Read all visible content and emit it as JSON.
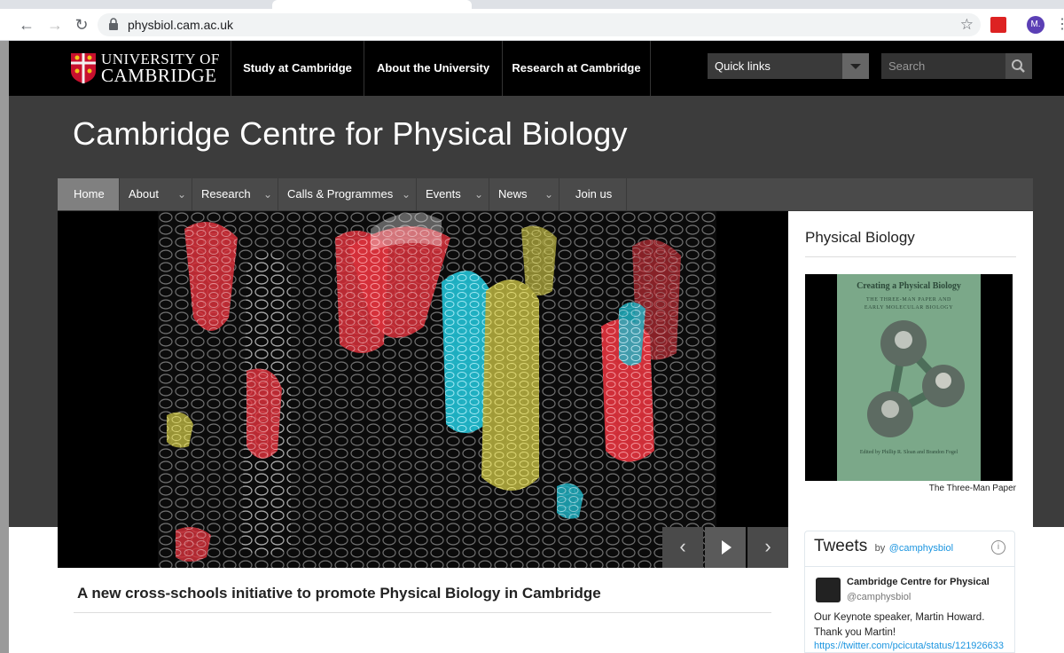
{
  "browser": {
    "url": "physbiol.cam.ac.uk",
    "profile_initial": "M."
  },
  "header": {
    "logo_line1": "UNIVERSITY OF",
    "logo_line2": "CAMBRIDGE",
    "nav": [
      "Study at Cambridge",
      "About the University",
      "Research at Cambridge"
    ],
    "quick_links_label": "Quick links",
    "search_placeholder": "Search"
  },
  "site_title": "Cambridge Centre for Physical Biology",
  "subnav": [
    {
      "label": "Home",
      "active": true,
      "dropdown": false
    },
    {
      "label": "About",
      "active": false,
      "dropdown": true
    },
    {
      "label": "Research",
      "active": false,
      "dropdown": true
    },
    {
      "label": "Calls & Programmes",
      "active": false,
      "dropdown": true
    },
    {
      "label": "Events",
      "active": false,
      "dropdown": true
    },
    {
      "label": "News",
      "active": false,
      "dropdown": true
    },
    {
      "label": "Join us",
      "active": false,
      "dropdown": false
    }
  ],
  "carousel": {
    "caption": "A new cross-schools initiative to promote Physical Biology in Cambridge"
  },
  "sidebar": {
    "title": "Physical Biology",
    "book_title": "Creating a Physical Biology",
    "book_subtitle_1": "THE THREE-MAN PAPER AND",
    "book_subtitle_2": "EARLY MOLECULAR BIOLOGY",
    "book_editors": "Edited by Phillip R. Sloan and Brandon Fogel",
    "book_caption": "The Three-Man Paper"
  },
  "tweets": {
    "title": "Tweets",
    "by": "by",
    "handle": "@camphysbiol",
    "author_name": "Cambridge Centre for Physical",
    "author_handle": "@camphysbiol",
    "text": "Our Keynote speaker, Martin Howard. Thank you Martin!",
    "link": "https://twitter.com/pcicuta/status/121926633"
  },
  "colors": {
    "header_bg": "#000000",
    "band_bg": "#3c3c3c",
    "subnav_bg": "#4a4a4a",
    "subnav_active": "#808080",
    "twitter_blue": "#1b95e0"
  }
}
